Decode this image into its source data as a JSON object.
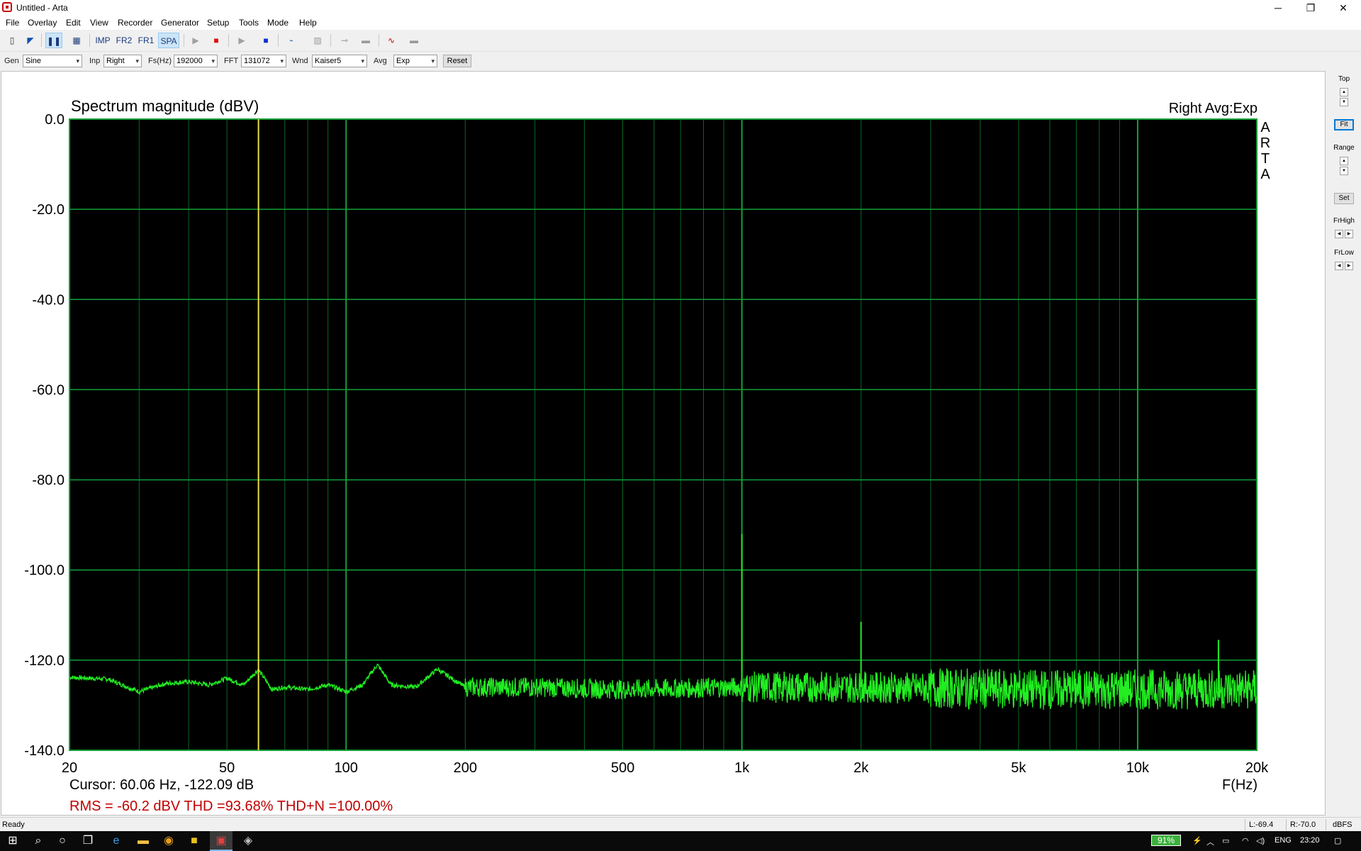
{
  "window": {
    "title": "Untitled - Arta",
    "minimize": "─",
    "restore": "❐",
    "close": "✕"
  },
  "menu": [
    "File",
    "Overlay",
    "Edit",
    "View",
    "Recorder",
    "Generator",
    "Setup",
    "Tools",
    "Mode",
    "Help"
  ],
  "toolbar": {
    "imp": "IMP",
    "fr2": "FR2",
    "fr1": "FR1",
    "spa": "SPA",
    "active_mode": "SPA"
  },
  "params": {
    "gen_label": "Gen",
    "gen_value": "Sine",
    "inp_label": "Inp",
    "inp_value": "Right",
    "fs_label": "Fs(Hz)",
    "fs_value": "192000",
    "fft_label": "FFT",
    "fft_value": "131072",
    "wnd_label": "Wnd",
    "wnd_value": "Kaiser5",
    "avg_label": "Avg",
    "avg_value": "Exp",
    "reset_label": "Reset"
  },
  "side_panel": {
    "top_label": "Top",
    "fit_label": "Fit",
    "range_label": "Range",
    "set_label": "Set",
    "frhigh_label": "FrHigh",
    "frlow_label": "FrLow"
  },
  "status": {
    "ready": "Ready",
    "left_level": "L:-69.4",
    "right_level": "R:-70.0",
    "units": "dBFS"
  },
  "taskbar": {
    "battery": "91%",
    "lang": "ENG",
    "time": "23:20"
  },
  "colors": {
    "plot_bg": "#000000",
    "grid": "#0a7a2a",
    "trace": "#22ee22",
    "cursor": "#e8e040",
    "stats": "#c00000"
  },
  "chart_data": {
    "type": "line",
    "title": "Spectrum magnitude (dBV)",
    "channel_label": "Right Avg:Exp",
    "watermark": [
      "A",
      "R",
      "T",
      "A"
    ],
    "xlabel": "F(Hz)",
    "x_scale": "log",
    "xlim": [
      20,
      20000
    ],
    "ylim": [
      -140,
      0
    ],
    "xticks": [
      20,
      50,
      100,
      200,
      500,
      1000,
      2000,
      5000,
      10000,
      20000
    ],
    "xtick_labels": [
      "20",
      "50",
      "100",
      "200",
      "500",
      "1k",
      "2k",
      "5k",
      "10k",
      "20k"
    ],
    "yticks": [
      0,
      -20,
      -40,
      -60,
      -80,
      -100,
      -120,
      -140
    ],
    "ytick_labels": [
      "0.0",
      "-20.0",
      "-40.0",
      "-60.0",
      "-80.0",
      "-100.0",
      "-120.0",
      "-140.0"
    ],
    "grid": true,
    "cursor": {
      "x": 60.06,
      "y": -122.09,
      "text": "Cursor: 60.06 Hz, -122.09 dB"
    },
    "stats_text": "RMS =  -60.2 dBV  THD =93.68%  THD+N =100.00%",
    "noise_floor": [
      [
        20,
        -123.8
      ],
      [
        25,
        -124.2
      ],
      [
        30,
        -127.0
      ],
      [
        35,
        -125.2
      ],
      [
        40,
        -124.8
      ],
      [
        45,
        -125.5
      ],
      [
        50,
        -124.0
      ],
      [
        55,
        -125.5
      ],
      [
        60,
        -122.1
      ],
      [
        65,
        -126.5
      ],
      [
        70,
        -126.0
      ],
      [
        80,
        -126.5
      ],
      [
        90,
        -125.5
      ],
      [
        100,
        -127.0
      ],
      [
        110,
        -125.5
      ],
      [
        120,
        -121.0
      ],
      [
        130,
        -125.5
      ],
      [
        150,
        -126.0
      ],
      [
        170,
        -122.0
      ],
      [
        200,
        -126.0
      ],
      [
        300,
        -126.0
      ],
      [
        500,
        -126.5
      ],
      [
        1000,
        -126.0
      ],
      [
        2000,
        -126.0
      ],
      [
        5000,
        -126.5
      ],
      [
        10000,
        -126.5
      ],
      [
        20000,
        -126.5
      ]
    ],
    "peaks": [
      {
        "freq": 1000,
        "level": -92.0
      },
      {
        "freq": 2000,
        "level": -111.5
      },
      {
        "freq": 16000,
        "level": -115.5
      }
    ]
  }
}
